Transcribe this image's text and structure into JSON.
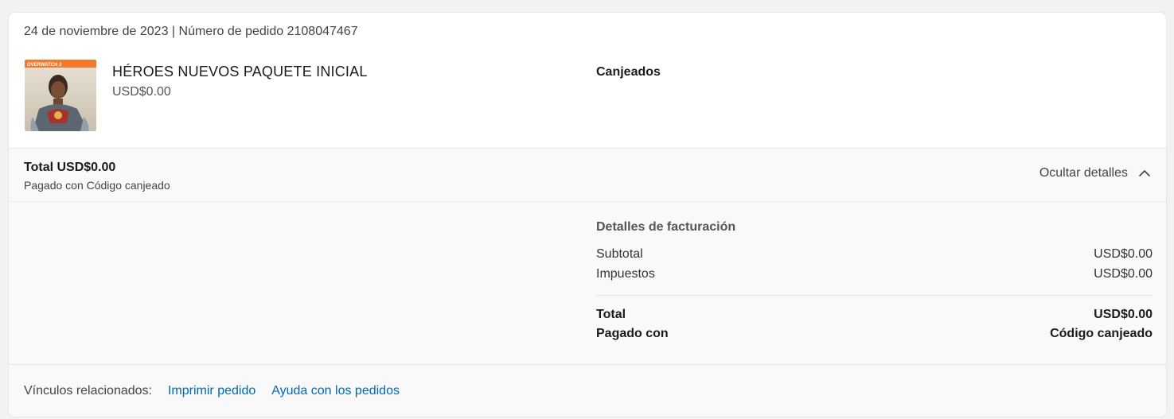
{
  "order": {
    "header": "24 de noviembre de 2023 | Número de pedido 2108047467"
  },
  "product": {
    "name": "HÉROES NUEVOS PAQUETE INICIAL",
    "price": "USD$0.00",
    "status": "Canjeados",
    "image_icon": "game-cover-image",
    "image_logo_text": "OVERWATCH 2"
  },
  "summary": {
    "total": "Total USD$0.00",
    "paid_with": "Pagado con Código canjeado",
    "toggle_label": "Ocultar detalles"
  },
  "billing": {
    "title": "Detalles de facturación",
    "subtotal_label": "Subtotal",
    "subtotal_value": "USD$0.00",
    "tax_label": "Impuestos",
    "tax_value": "USD$0.00",
    "total_label": "Total",
    "total_value": "USD$0.00",
    "paid_label": "Pagado con",
    "paid_value": "Código canjeado"
  },
  "footer": {
    "label": "Vínculos relacionados:",
    "print_link": "Imprimir pedido",
    "help_link": "Ayuda con los pedidos"
  },
  "colors": {
    "link": "#0067b8",
    "background": "#f2f2f2",
    "card": "#ffffff"
  }
}
